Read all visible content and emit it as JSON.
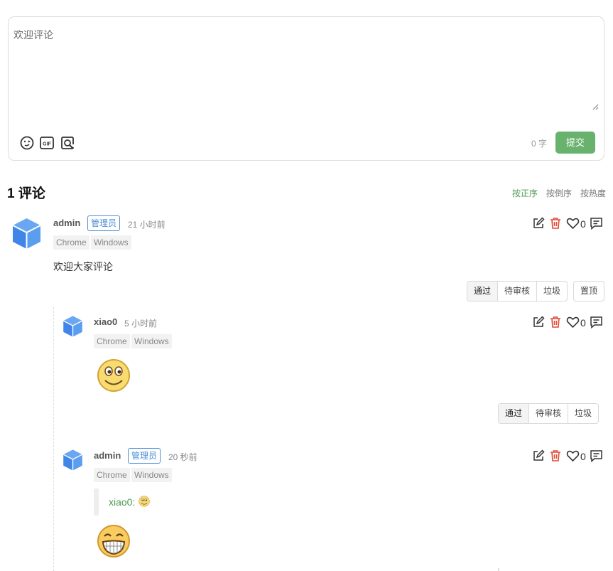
{
  "editor": {
    "placeholder": "欢迎评论",
    "icons": [
      "emoji-icon",
      "gif-icon",
      "search-image-icon"
    ],
    "word_count": "0 字",
    "submit_label": "提交"
  },
  "comments_header": {
    "title": "1 评论",
    "sort_options": [
      "按正序",
      "按倒序",
      "按热度"
    ],
    "active_sort": "按正序"
  },
  "comments": [
    {
      "author": "admin",
      "badge": "管理员",
      "time": "21 小时前",
      "tags": [
        "Chrome",
        "Windows"
      ],
      "content": "欢迎大家评论",
      "likes": "0",
      "moderation": [
        "通过",
        "待审核",
        "垃圾"
      ],
      "pin_label": "置顶"
    }
  ],
  "replies": [
    {
      "author": "xiao0",
      "time": "5 小时前",
      "tags": [
        "Chrome",
        "Windows"
      ],
      "content_emoji": "smile-emoji",
      "likes": "0",
      "moderation": [
        "通过",
        "待审核",
        "垃圾"
      ]
    },
    {
      "author": "admin",
      "badge": "管理员",
      "time": "20 秒前",
      "tags": [
        "Chrome",
        "Windows"
      ],
      "quote": "xiao0:",
      "content_emoji": "grin-emoji",
      "likes": "0"
    }
  ],
  "colors": {
    "accent_green": "#68b26d",
    "badge_blue": "#4b8ed7",
    "delete_red": "#e24a36"
  }
}
